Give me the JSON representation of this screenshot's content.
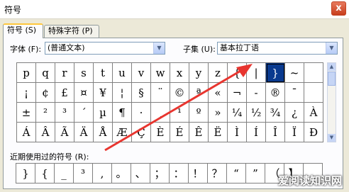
{
  "window": {
    "title": "符号",
    "close_label": "x"
  },
  "tabs": [
    {
      "label": "符号 (S)"
    },
    {
      "label": "特殊字符 (P)"
    }
  ],
  "font": {
    "label": "字体 (F):",
    "value": "(普通文本)"
  },
  "subset": {
    "label": "子集 (U):",
    "value": "基本拉丁语"
  },
  "symbols": [
    [
      "p",
      "q",
      "r",
      "s",
      "t",
      "u",
      "v",
      "w",
      "x",
      "y",
      "z",
      "{",
      "|",
      "}",
      "~",
      ""
    ],
    [
      "¡",
      "¢",
      "£",
      "¤",
      "¥",
      "¦",
      "§",
      "¨",
      "©",
      "ª",
      "«",
      "¬",
      "-",
      "®",
      "¯",
      ""
    ],
    [
      "±",
      "²",
      "³",
      "´",
      "µ",
      "¶",
      "·",
      "¸",
      "¹",
      "º",
      "»",
      "¼",
      "½",
      "¾",
      "¿",
      "À"
    ],
    [
      "Á",
      "Â",
      "Ã",
      "Ä",
      "Å",
      "Æ",
      "Ç",
      "È",
      "É",
      "Ê",
      "Ë",
      "Ì",
      "Í",
      "Î",
      "Ï",
      "Ð"
    ]
  ],
  "selected_symbol": "}",
  "recent": {
    "label": "近期使用过的符号 (R):",
    "items": [
      "}",
      "{",
      "_",
      "³",
      ",",
      "。",
      "、",
      "；",
      "：",
      "！",
      "？",
      "“",
      "”",
      "（",
      "】",
      ""
    ]
  },
  "colors": {
    "arrow": "#e8352f",
    "selection": "#0a3a8f",
    "tab_highlight": "#ffc73c"
  },
  "icons": {
    "close": "close-icon",
    "dropdown": "chevron-down-icon"
  },
  "watermark": "爱阅读知识网"
}
